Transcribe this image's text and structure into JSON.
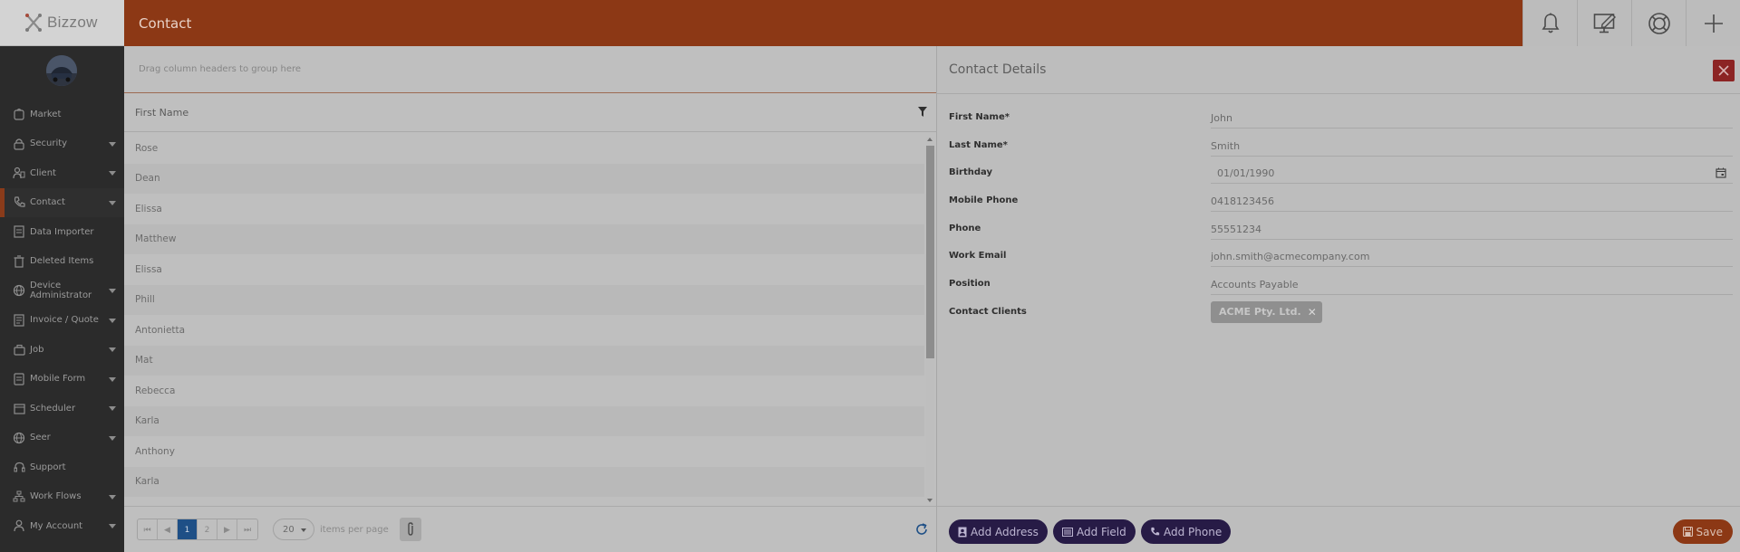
{
  "app": {
    "logo_text": "Bizzow",
    "page_title": "Contact"
  },
  "topbar": {
    "icons": [
      "bell-icon",
      "edit-screen-icon",
      "help-lifebuoy-icon",
      "plus-icon"
    ]
  },
  "sidebar": {
    "items": [
      {
        "label": "Market",
        "icon": "market-icon",
        "has_caret": false
      },
      {
        "label": "Security",
        "icon": "lock-icon",
        "has_caret": true
      },
      {
        "label": "Client",
        "icon": "client-icon",
        "has_caret": true
      },
      {
        "label": "Contact",
        "icon": "phone-icon",
        "has_caret": true,
        "active": true
      },
      {
        "label": "Data Importer",
        "icon": "data-importer-icon",
        "has_caret": false
      },
      {
        "label": "Deleted Items",
        "icon": "trash-icon",
        "has_caret": false
      },
      {
        "label": "Device Administrator",
        "icon": "globe-gear-icon",
        "has_caret": true
      },
      {
        "label": "Invoice / Quote",
        "icon": "invoice-icon",
        "has_caret": true
      },
      {
        "label": "Job",
        "icon": "job-icon",
        "has_caret": true
      },
      {
        "label": "Mobile Form",
        "icon": "mobile-form-icon",
        "has_caret": true
      },
      {
        "label": "Scheduler",
        "icon": "calendar-icon",
        "has_caret": true
      },
      {
        "label": "Seer",
        "icon": "globe-icon",
        "has_caret": true
      },
      {
        "label": "Support",
        "icon": "support-icon",
        "has_caret": false
      },
      {
        "label": "Work Flows",
        "icon": "workflow-icon",
        "has_caret": true
      },
      {
        "label": "My Account",
        "icon": "user-icon",
        "has_caret": true
      }
    ]
  },
  "grid": {
    "group_hint": "Drag column headers to group here",
    "column_header": "First Name",
    "rows": [
      "Rose",
      "Dean",
      "Elissa",
      "Matthew",
      "Elissa",
      "Phill",
      "Antonietta",
      "Mat",
      "Rebecca",
      "Karla",
      "Anthony",
      "Karla"
    ],
    "pager": {
      "first": "⏮",
      "prev": "◀",
      "pages": [
        "1",
        "2"
      ],
      "active_page": "1",
      "next": "▶",
      "last": "⏭",
      "page_size": "20",
      "per_page_label": "items per page"
    }
  },
  "details": {
    "title": "Contact Details",
    "fields": [
      {
        "label": "First Name*",
        "value": "John"
      },
      {
        "label": "Last Name*",
        "value": "Smith"
      },
      {
        "label": "Birthday",
        "value": "01/01/1990"
      },
      {
        "label": "Mobile Phone",
        "value": "0418123456"
      },
      {
        "label": "Phone",
        "value": "55551234"
      },
      {
        "label": "Work Email",
        "value": "john.smith@acmecompany.com"
      },
      {
        "label": "Position",
        "value": "Accounts Payable"
      },
      {
        "label": "Contact Clients",
        "chip": "ACME Pty. Ltd."
      }
    ],
    "buttons": {
      "add_address": "Add Address",
      "add_field": "Add Field",
      "add_phone": "Add Phone",
      "save": "Save"
    }
  },
  "colors": {
    "brand_orange": "#8c3815",
    "sidebar_bg": "#2b2b2b",
    "primary_purple": "#271b46",
    "close_red": "#8c2424",
    "pager_active": "#1e4f86"
  }
}
